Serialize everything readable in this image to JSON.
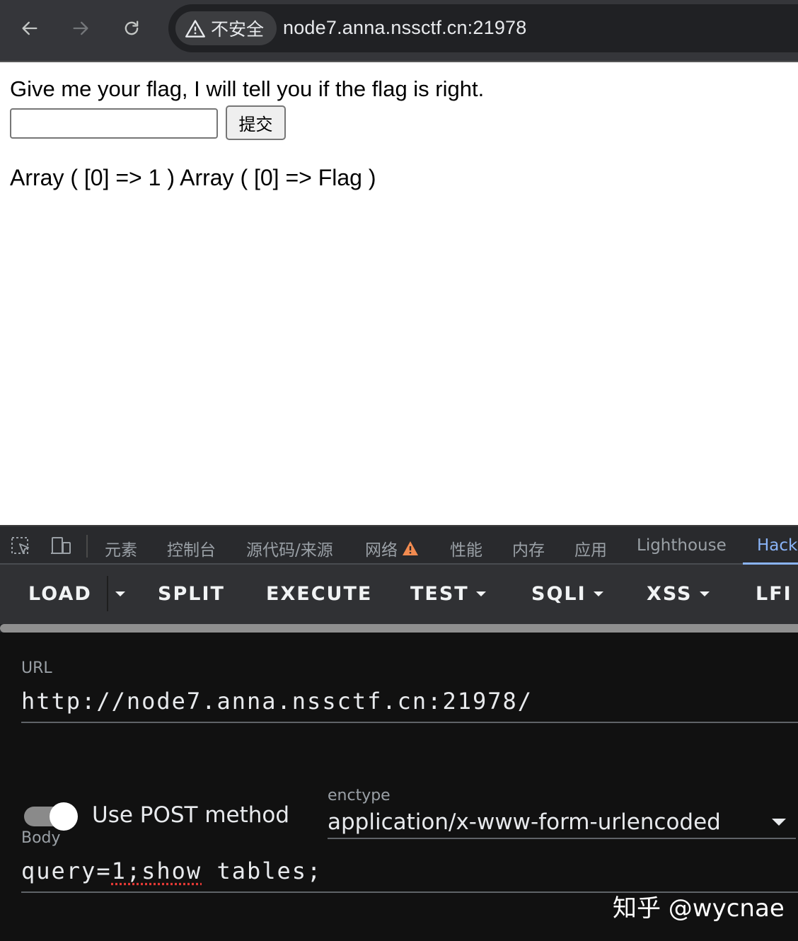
{
  "browser": {
    "security_label": "不安全",
    "url": "node7.anna.nssctf.cn:21978"
  },
  "page": {
    "prompt": "Give me your flag, I will tell you if the flag is right.",
    "input_value": "",
    "submit_label": "提交",
    "result": "Array ( [0] => 1 ) Array ( [0] => Flag )"
  },
  "devtools": {
    "tabs": [
      {
        "label": "元素"
      },
      {
        "label": "控制台"
      },
      {
        "label": "源代码/来源"
      },
      {
        "label": "网络"
      },
      {
        "label": "性能"
      },
      {
        "label": "内存"
      },
      {
        "label": "应用"
      },
      {
        "label": "Lighthouse"
      },
      {
        "label": "Hack"
      }
    ],
    "active_tab": "Hack"
  },
  "hackbar": {
    "toolbar": {
      "load": "LOAD",
      "split": "SPLIT",
      "execute": "EXECUTE",
      "test": "TEST",
      "sqli": "SQLI",
      "xss": "XSS",
      "lfi": "LFI"
    },
    "url_label": "URL",
    "url_value": "http://node7.anna.nssctf.cn:21978/",
    "post_toggle_label": "Use POST method",
    "post_enabled": true,
    "enctype_label": "enctype",
    "enctype_value": "application/x-www-form-urlencoded",
    "body_label": "Body",
    "body_prefix": "query=",
    "body_flagged": "1;show",
    "body_suffix": " tables;"
  },
  "watermark": "知乎 @wycnae",
  "colors": {
    "accent": "#8ab4f8",
    "warning": "#f28b50"
  }
}
